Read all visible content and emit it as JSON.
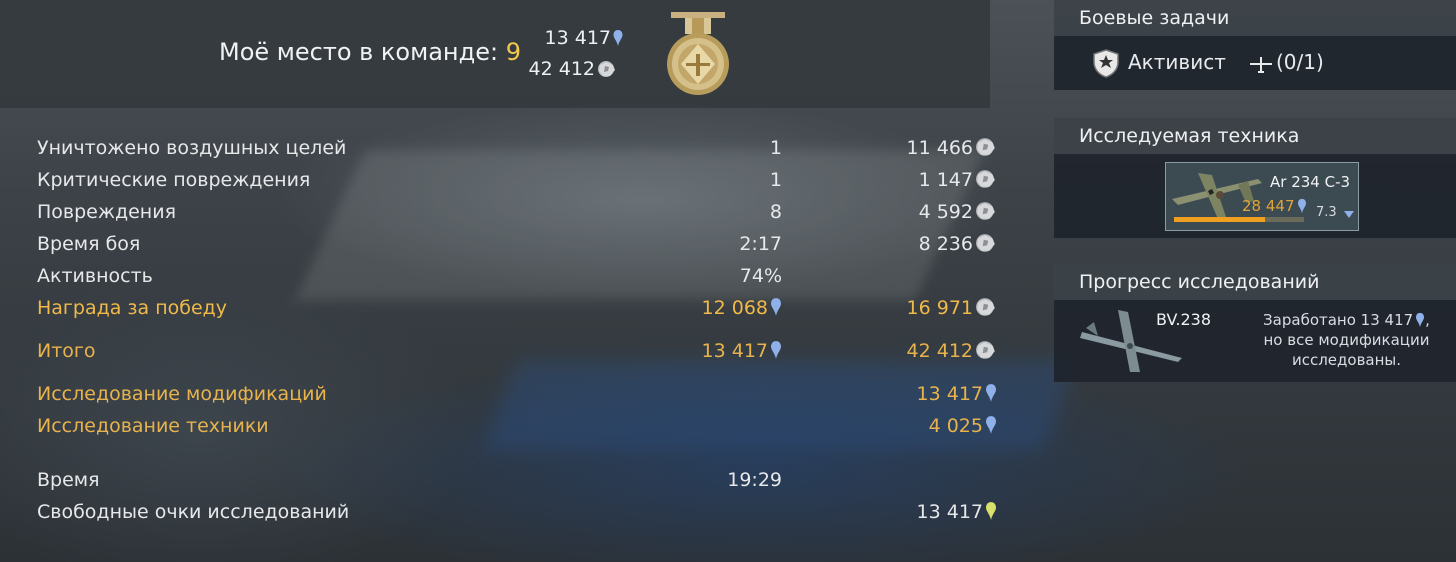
{
  "header": {
    "place_label": "Моё место в команде:",
    "place_value": "9",
    "rp_total": "13 417",
    "sl_total": "42 412"
  },
  "stats": [
    {
      "label": "Уничтожено воздушных целей",
      "value": "1",
      "reward": "11 466",
      "reward_icon": "silver-lion-icon"
    },
    {
      "label": "Критические повреждения",
      "value": "1",
      "reward": "1 147",
      "reward_icon": "silver-lion-icon"
    },
    {
      "label": "Повреждения",
      "value": "8",
      "reward": "4 592",
      "reward_icon": "silver-lion-icon"
    },
    {
      "label": "Время боя",
      "value": "2:17",
      "reward": "8 236",
      "reward_icon": "silver-lion-icon"
    },
    {
      "label": "Активность",
      "value": "74%",
      "reward": ""
    },
    {
      "label": "Награда за победу",
      "value": "12 068",
      "value_icon": "research-point-icon",
      "reward": "16 971",
      "reward_icon": "silver-lion-icon"
    },
    {
      "label": "Итого",
      "value": "13 417",
      "value_icon": "research-point-icon",
      "reward": "42 412",
      "reward_icon": "silver-lion-icon"
    },
    {
      "label": "Исследование модификаций",
      "value": "",
      "reward": "13 417",
      "reward_icon": "research-point-icon"
    },
    {
      "label": "Исследование техники",
      "value": "",
      "reward": "4 025",
      "reward_icon": "research-point-icon"
    },
    {
      "label": "Время",
      "value": "19:29",
      "reward": ""
    },
    {
      "label": "Свободные очки исследований",
      "value": "",
      "reward": "13 417",
      "reward_icon": "free-research-point-icon"
    }
  ],
  "battle_tasks": {
    "title": "Боевые задачи",
    "task_name": "Активист",
    "task_count": "(0/1)"
  },
  "research_vehicle": {
    "title": "Исследуемая техника",
    "name": "Ar 234 C-3",
    "rp": "28 447",
    "battle_rating": "7.3",
    "progress": 0.7
  },
  "research_progress": {
    "title": "Прогресс исследований",
    "vehicle_name": "BV.238",
    "text_line1": "Заработано 13 417",
    "text_line2": "но все модификации",
    "text_line3": "исследованы."
  },
  "colors": {
    "gold": "#f0b94a",
    "rp_blue": "#8fb0e8",
    "free_rp": "#d8e26a"
  }
}
